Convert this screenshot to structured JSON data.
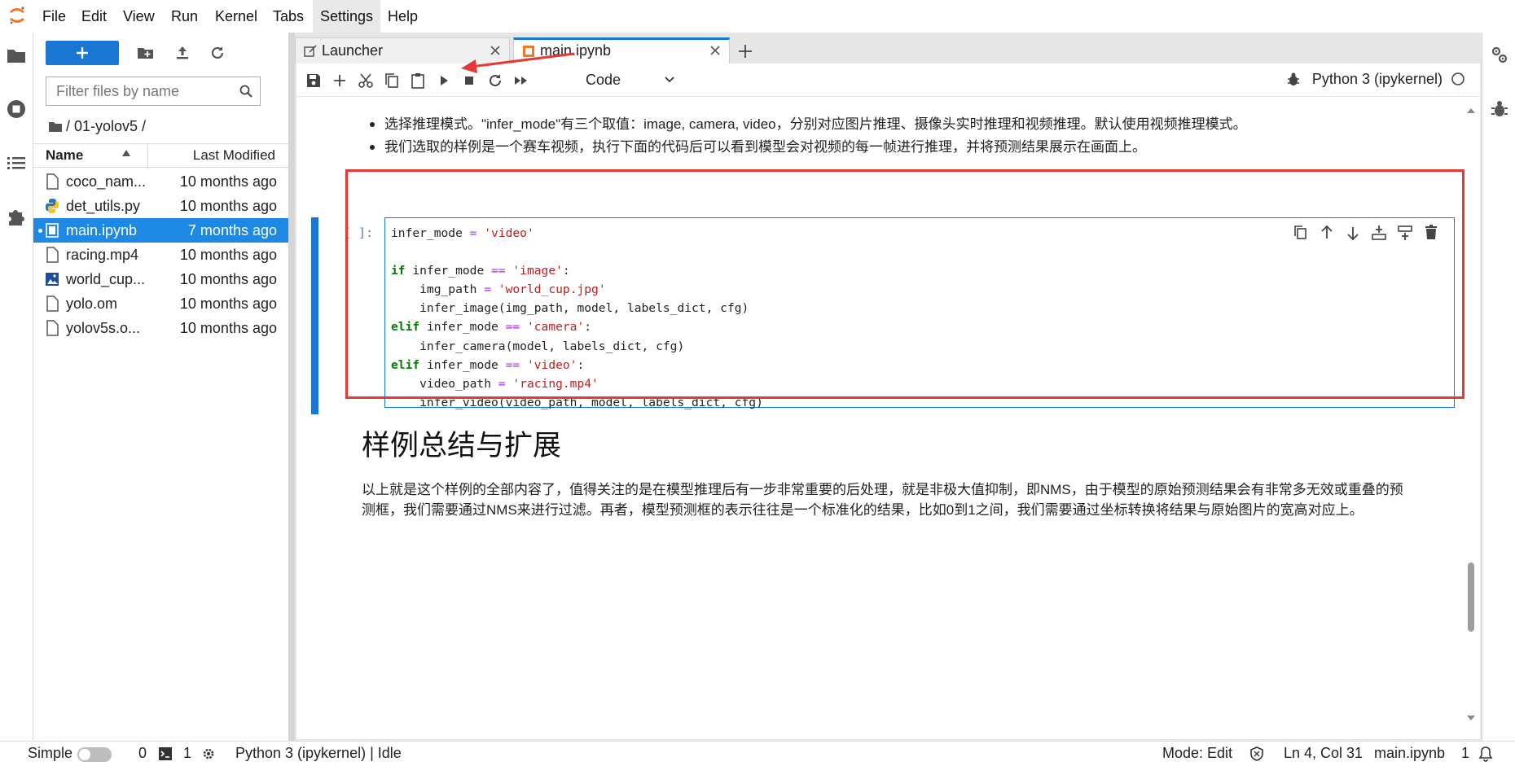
{
  "menubar": {
    "items": [
      "File",
      "Edit",
      "View",
      "Run",
      "Kernel",
      "Tabs",
      "Settings",
      "Help"
    ],
    "active": "Settings"
  },
  "filebrowser": {
    "new_button_label": "+",
    "filter_placeholder": "Filter files by name",
    "breadcrumb": "/ 01-yolov5 /",
    "col_name": "Name",
    "col_modified": "Last Modified",
    "files": [
      {
        "name": "coco_nam...",
        "modified": "10 months ago",
        "icon": "text-file-icon"
      },
      {
        "name": "det_utils.py",
        "modified": "10 months ago",
        "icon": "python-file-icon"
      },
      {
        "name": "main.ipynb",
        "modified": "7 months ago",
        "icon": "notebook-icon"
      },
      {
        "name": "racing.mp4",
        "modified": "10 months ago",
        "icon": "text-file-icon"
      },
      {
        "name": "world_cup...",
        "modified": "10 months ago",
        "icon": "image-file-icon"
      },
      {
        "name": "yolo.om",
        "modified": "10 months ago",
        "icon": "text-file-icon"
      },
      {
        "name": "yolov5s.o...",
        "modified": "10 months ago",
        "icon": "text-file-icon"
      }
    ],
    "selected_index": 2
  },
  "tabs": {
    "launcher": "Launcher",
    "notebook": "main.ipynb",
    "add": "+"
  },
  "toolbar": {
    "cell_type": "Code",
    "kernel_name": "Python 3 (ipykernel)"
  },
  "notebook": {
    "bullets": [
      "选择推理模式。\"infer_mode\"有三个取值：image, camera, video，分别对应图片推理、摄像头实时推理和视频推理。默认使用视频推理模式。",
      "我们选取的样例是一个赛车视频，执行下面的代码后可以看到模型会对视频的每一帧进行推理，并将预测结果展示在画面上。"
    ],
    "cell_prompt": "[ ]:",
    "heading": "样例总结与扩展",
    "summary": "以上就是这个样例的全部内容了，值得关注的是在模型推理后有一步非常重要的后处理，就是非极大值抑制，即NMS，由于模型的原始预测结果会有非常多无效或重叠的预测框，我们需要通过NMS来进行过滤。再者，模型预测框的表示往往是一个标准化的结果，比如0到1之间，我们需要通过坐标转换将结果与原始图片的宽高对应上。"
  },
  "statusbar": {
    "mode_label": "Simple",
    "terminals": "0",
    "kernels": "1",
    "kernel_status": "Python 3 (ipykernel) | Idle",
    "mode": "Mode: Edit",
    "cursor": "Ln 4, Col 31",
    "filename": "main.ipynb",
    "notifications": "1"
  },
  "colors": {
    "accent": "#1976d2",
    "selected_row": "#1e88e5",
    "annotation": "#e53935",
    "keyword": "#008000",
    "string": "#ba2121"
  }
}
